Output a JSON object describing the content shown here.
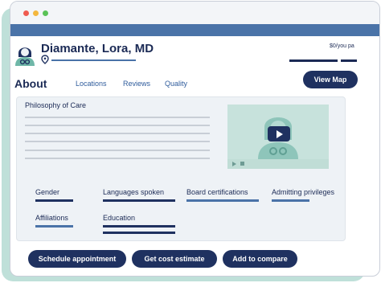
{
  "doctor": {
    "name": "Diamante, Lora, MD",
    "price": "$0/you pa"
  },
  "tabs": {
    "about": "About",
    "locations": "Locations",
    "reviews": "Reviews",
    "quality": "Quality"
  },
  "buttons": {
    "view_map": "View Map",
    "schedule": "Schedule appointment",
    "cost": "Get cost estimate",
    "compare": "Add to compare"
  },
  "panel": {
    "philosophy_title": "Philosophy of Care",
    "attributes": {
      "gender": "Gender",
      "languages": "Languages spoken",
      "board": "Board certifications",
      "admitting": "Admitting privileges",
      "affiliations": "Affiliations",
      "education": "Education"
    }
  },
  "colors": {
    "navy": "#1f3160",
    "accent_blue": "#4a73a8",
    "mint": "#bfe0d9",
    "panel_bg": "#eef2f6"
  },
  "icons": [
    "doctor-avatar-icon",
    "location-pin-icon",
    "play-icon",
    "stop-icon"
  ]
}
